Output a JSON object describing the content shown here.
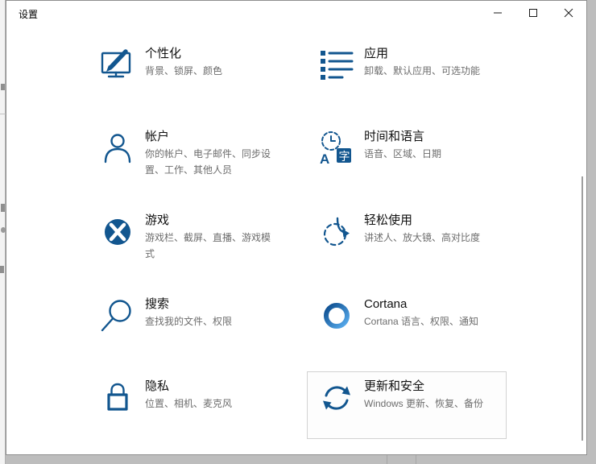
{
  "window": {
    "title": "设置",
    "controls": {
      "minimize": "minimize",
      "maximize": "maximize",
      "close": "close"
    }
  },
  "tiles": [
    {
      "id": "personalization",
      "title": "个性化",
      "subtitle": "背景、锁屏、颜色"
    },
    {
      "id": "apps",
      "title": "应用",
      "subtitle": "卸载、默认应用、可选功能"
    },
    {
      "id": "accounts",
      "title": "帐户",
      "subtitle": "你的帐户、电子邮件、同步设置、工作、其他人员"
    },
    {
      "id": "time-language",
      "title": "时间和语言",
      "subtitle": "语音、区域、日期"
    },
    {
      "id": "gaming",
      "title": "游戏",
      "subtitle": "游戏栏、截屏、直播、游戏模式"
    },
    {
      "id": "ease-of-access",
      "title": "轻松使用",
      "subtitle": "讲述人、放大镜、高对比度"
    },
    {
      "id": "search",
      "title": "搜索",
      "subtitle": "查找我的文件、权限"
    },
    {
      "id": "cortana",
      "title": "Cortana",
      "subtitle": "Cortana 语言、权限、通知"
    },
    {
      "id": "privacy",
      "title": "隐私",
      "subtitle": "位置、相机、麦克风"
    },
    {
      "id": "update-security",
      "title": "更新和安全",
      "subtitle": "Windows 更新、恢复、备份",
      "highlighted": true
    }
  ],
  "colors": {
    "icon_blue": "#12568f",
    "cortana_blue_dark": "#0b4b8c",
    "cortana_blue_light": "#5aaef0",
    "title_text": "#111111",
    "subtitle_text": "#6d6d6d",
    "highlight_border": "#d2d2d2",
    "window_bg": "#ffffff"
  }
}
